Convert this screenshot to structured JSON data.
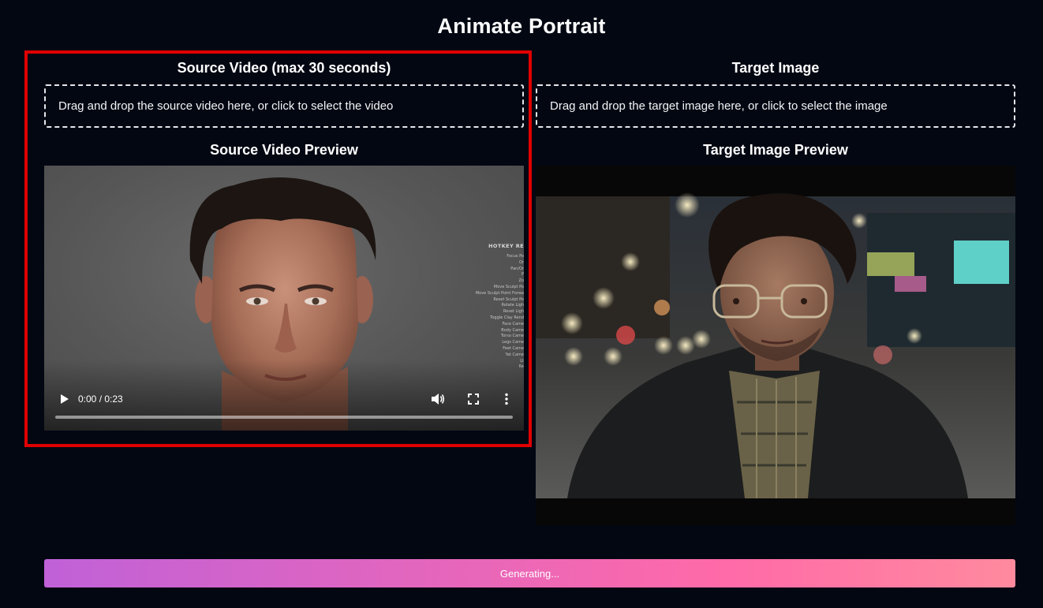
{
  "app": {
    "title": "Animate Portrait"
  },
  "source": {
    "section_title": "Source Video (max 30 seconds)",
    "dropzone_text": "Drag and drop the source video here, or click to select the video",
    "preview_title": "Source Video Preview",
    "video": {
      "time": "0:00 / 0:23",
      "progress": 0,
      "overlay_title": "HOTKEY RE",
      "overlay_lines": [
        "Focus Po",
        "Or",
        "Pan/Or",
        "P",
        "Zo",
        "Move Sculpt Po",
        "Move Sculpt Point Forwa",
        "Reset Sculpt Po",
        "Rotate Ligh",
        "Reset Ligh",
        "Toggle Clay Rend",
        "Face Came",
        "Body Came",
        "Torso Came",
        "Legs Came",
        "Feet Came",
        "Yat Came",
        "Lt",
        "Re"
      ]
    }
  },
  "target": {
    "section_title": "Target Image",
    "dropzone_text": "Drag and drop the target image here, or click to select the image",
    "preview_title": "Target Image Preview"
  },
  "generate": {
    "label": "Generating..."
  },
  "colors": {
    "background": "#030712",
    "highlight": "#e00000",
    "button_gradient_start": "#c061d8",
    "button_gradient_end": "#ff8a9e"
  },
  "icons": {
    "play": "play-icon",
    "volume": "volume-icon",
    "fullscreen": "fullscreen-icon",
    "more": "more-vertical-icon"
  }
}
